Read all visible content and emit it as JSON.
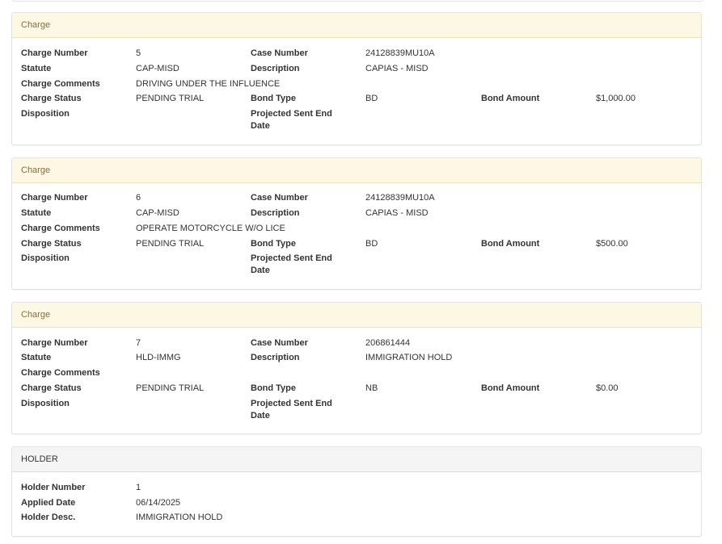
{
  "charges": [
    {
      "heading": "Charge",
      "charge_number_label": "Charge Number",
      "charge_number": "5",
      "case_number_label": "Case Number",
      "case_number": "24128839MU10A",
      "statute_label": "Statute",
      "statute": "CAP-MISD",
      "description_label": "Description",
      "description": "CAPIAS - MISD",
      "comments_label": "Charge Comments",
      "comments": "DRIVING UNDER THE INFLUENCE",
      "status_label": "Charge Status",
      "status": "PENDING TRIAL",
      "bond_type_label": "Bond Type",
      "bond_type": "BD",
      "bond_amount_label": "Bond Amount",
      "bond_amount": "$1,000.00",
      "disposition_label": "Disposition",
      "projected_label": "Projected Sent End Date"
    },
    {
      "heading": "Charge",
      "charge_number_label": "Charge Number",
      "charge_number": "6",
      "case_number_label": "Case Number",
      "case_number": "24128839MU10A",
      "statute_label": "Statute",
      "statute": "CAP-MISD",
      "description_label": "Description",
      "description": "CAPIAS - MISD",
      "comments_label": "Charge Comments",
      "comments": "OPERATE MOTORCYCLE W/O LICE",
      "status_label": "Charge Status",
      "status": "PENDING TRIAL",
      "bond_type_label": "Bond Type",
      "bond_type": "BD",
      "bond_amount_label": "Bond Amount",
      "bond_amount": "$500.00",
      "disposition_label": "Disposition",
      "projected_label": "Projected Sent End Date"
    },
    {
      "heading": "Charge",
      "charge_number_label": "Charge Number",
      "charge_number": "7",
      "case_number_label": "Case Number",
      "case_number": "206861444",
      "statute_label": "Statute",
      "statute": "HLD-IMMG",
      "description_label": "Description",
      "description": "IMMIGRATION HOLD",
      "comments_label": "Charge Comments",
      "comments": "",
      "status_label": "Charge Status",
      "status": "PENDING TRIAL",
      "bond_type_label": "Bond Type",
      "bond_type": "NB",
      "bond_amount_label": "Bond Amount",
      "bond_amount": "$0.00",
      "disposition_label": "Disposition",
      "projected_label": "Projected Sent End Date"
    }
  ],
  "holder": {
    "heading": "HOLDER",
    "holder_number_label": "Holder Number",
    "holder_number": "1",
    "applied_date_label": "Applied Date",
    "applied_date": "06/14/2025",
    "holder_desc_label": "Holder Desc.",
    "holder_desc": "IMMIGRATION HOLD"
  },
  "colors": {
    "charge_heading_bg": "#fcf8e4",
    "charge_heading_text": "#8a6d3b",
    "holder_heading_bg": "#f5f5f5"
  }
}
